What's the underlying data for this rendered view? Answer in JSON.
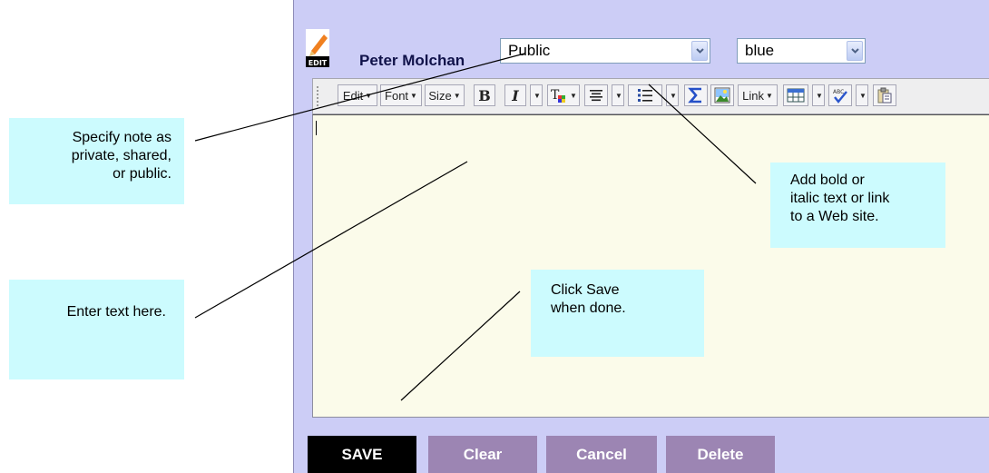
{
  "editor": {
    "user_name": "Peter Molchan",
    "edit_icon_label": "EDIT",
    "visibility_select": {
      "value": "Public"
    },
    "color_select": {
      "value": "blue"
    },
    "toolbar": {
      "edit_label": "Edit",
      "font_label": "Font",
      "size_label": "Size",
      "bold_label": "B",
      "italic_label": "I",
      "link_label": "Link",
      "icons": [
        "text-color-icon",
        "align-icon",
        "list-icon",
        "sum-icon",
        "image-icon",
        "table-icon",
        "spellcheck-icon",
        "paste-icon"
      ]
    },
    "buttons": {
      "save": "SAVE",
      "clear": "Clear",
      "cancel": "Cancel",
      "delete": "Delete"
    }
  },
  "callouts": {
    "visibility": [
      "Specify note as",
      "private, shared,",
      "or public."
    ],
    "text": [
      "Enter text here."
    ],
    "formatting": [
      "Add bold or",
      "italic text or link",
      "to a Web site."
    ],
    "save": [
      "Click Save",
      "when done."
    ]
  },
  "colors": {
    "panel_bg": "#cccdf6",
    "editor_bg": "#fbfbea",
    "callout_bg": "#ccfbfe",
    "save_bg": "#000000",
    "button_bg": "#9c85b3"
  }
}
